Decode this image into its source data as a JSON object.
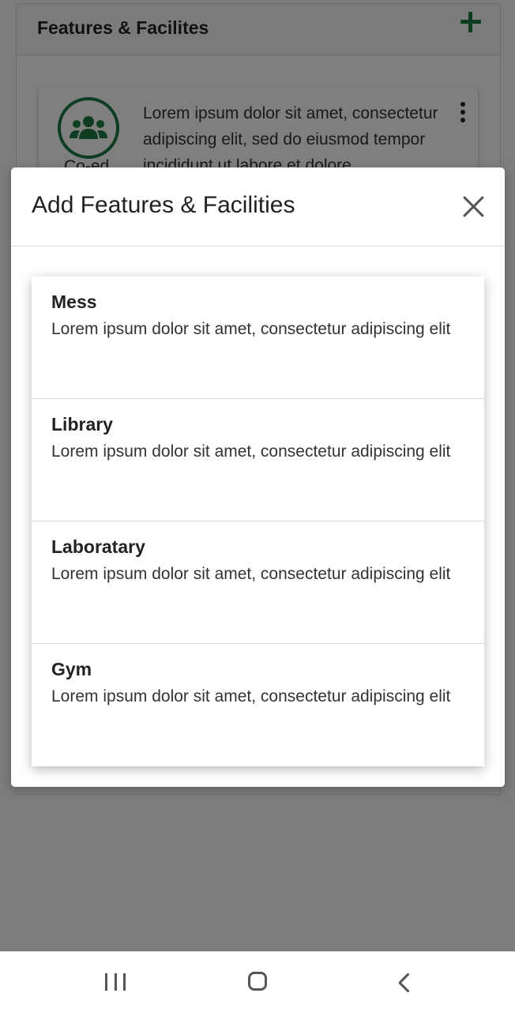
{
  "background": {
    "section_title": "Features & Facilites",
    "add_icon": "plus-icon",
    "feature_card": {
      "icon": "users-group-icon",
      "label": "Co-ed",
      "description": "Lorem ipsum dolor sit amet, consectetur adipiscing elit, sed do eiusmod tempor incididunt ut labore et dolore",
      "menu_icon": "kebab-menu-icon"
    }
  },
  "modal": {
    "title": "Add Features & Facilities",
    "close_icon": "close-icon",
    "options": [
      {
        "title": "Mess",
        "description": "Lorem ipsum dolor sit amet, consectetur adipiscing elit"
      },
      {
        "title": "Library",
        "description": "Lorem ipsum dolor sit amet, consectetur adipiscing elit"
      },
      {
        "title": "Laboratary",
        "description": "Lorem ipsum dolor sit amet, consectetur adipiscing elit"
      },
      {
        "title": "Gym",
        "description": "Lorem ipsum dolor sit amet, consectetur adipiscing elit"
      }
    ]
  },
  "navbar": {
    "recents_icon": "recents-icon",
    "home_icon": "home-icon",
    "back_icon": "back-icon"
  },
  "colors": {
    "accent": "#1e7a45",
    "scrim": "rgba(0,0,0,0.5)"
  }
}
